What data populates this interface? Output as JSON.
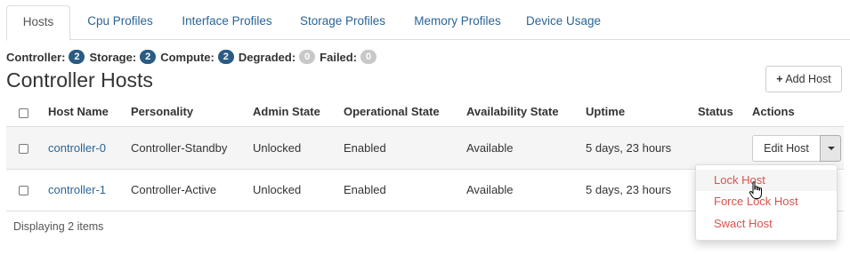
{
  "tabs": [
    {
      "label": "Hosts",
      "active": true
    },
    {
      "label": "Cpu Profiles"
    },
    {
      "label": "Interface Profiles"
    },
    {
      "label": "Storage Profiles"
    },
    {
      "label": "Memory Profiles"
    },
    {
      "label": "Device Usage"
    }
  ],
  "summary": [
    {
      "label": "Controller:",
      "count": "2",
      "color": "#2a5b84"
    },
    {
      "label": "Storage:",
      "count": "2",
      "color": "#2a5b84"
    },
    {
      "label": "Compute:",
      "count": "2",
      "color": "#2a5b84"
    },
    {
      "label": "Degraded:",
      "count": "0",
      "color": "#c8c8c8"
    },
    {
      "label": "Failed:",
      "count": "0",
      "color": "#c8c8c8"
    }
  ],
  "title": "Controller Hosts",
  "add_host_label": "Add Host",
  "columns": [
    "Host Name",
    "Personality",
    "Admin State",
    "Operational State",
    "Availability State",
    "Uptime",
    "Status",
    "Actions"
  ],
  "rows": [
    {
      "host": "controller-0",
      "personality": "Controller-Standby",
      "admin": "Unlocked",
      "operational": "Enabled",
      "availability": "Available",
      "uptime": "5 days, 23 hours",
      "status": "",
      "action": "Edit Host"
    },
    {
      "host": "controller-1",
      "personality": "Controller-Active",
      "admin": "Unlocked",
      "operational": "Enabled",
      "availability": "Available",
      "uptime": "5 days, 23 hours",
      "status": ""
    }
  ],
  "footer": "Displaying 2 items",
  "menu": [
    "Lock Host",
    "Force Lock Host",
    "Swact Host"
  ],
  "colors": {
    "link": "#2a6496",
    "danger": "#d9534f",
    "badge_active": "#2a5b84",
    "badge_zero": "#c8c8c8"
  }
}
